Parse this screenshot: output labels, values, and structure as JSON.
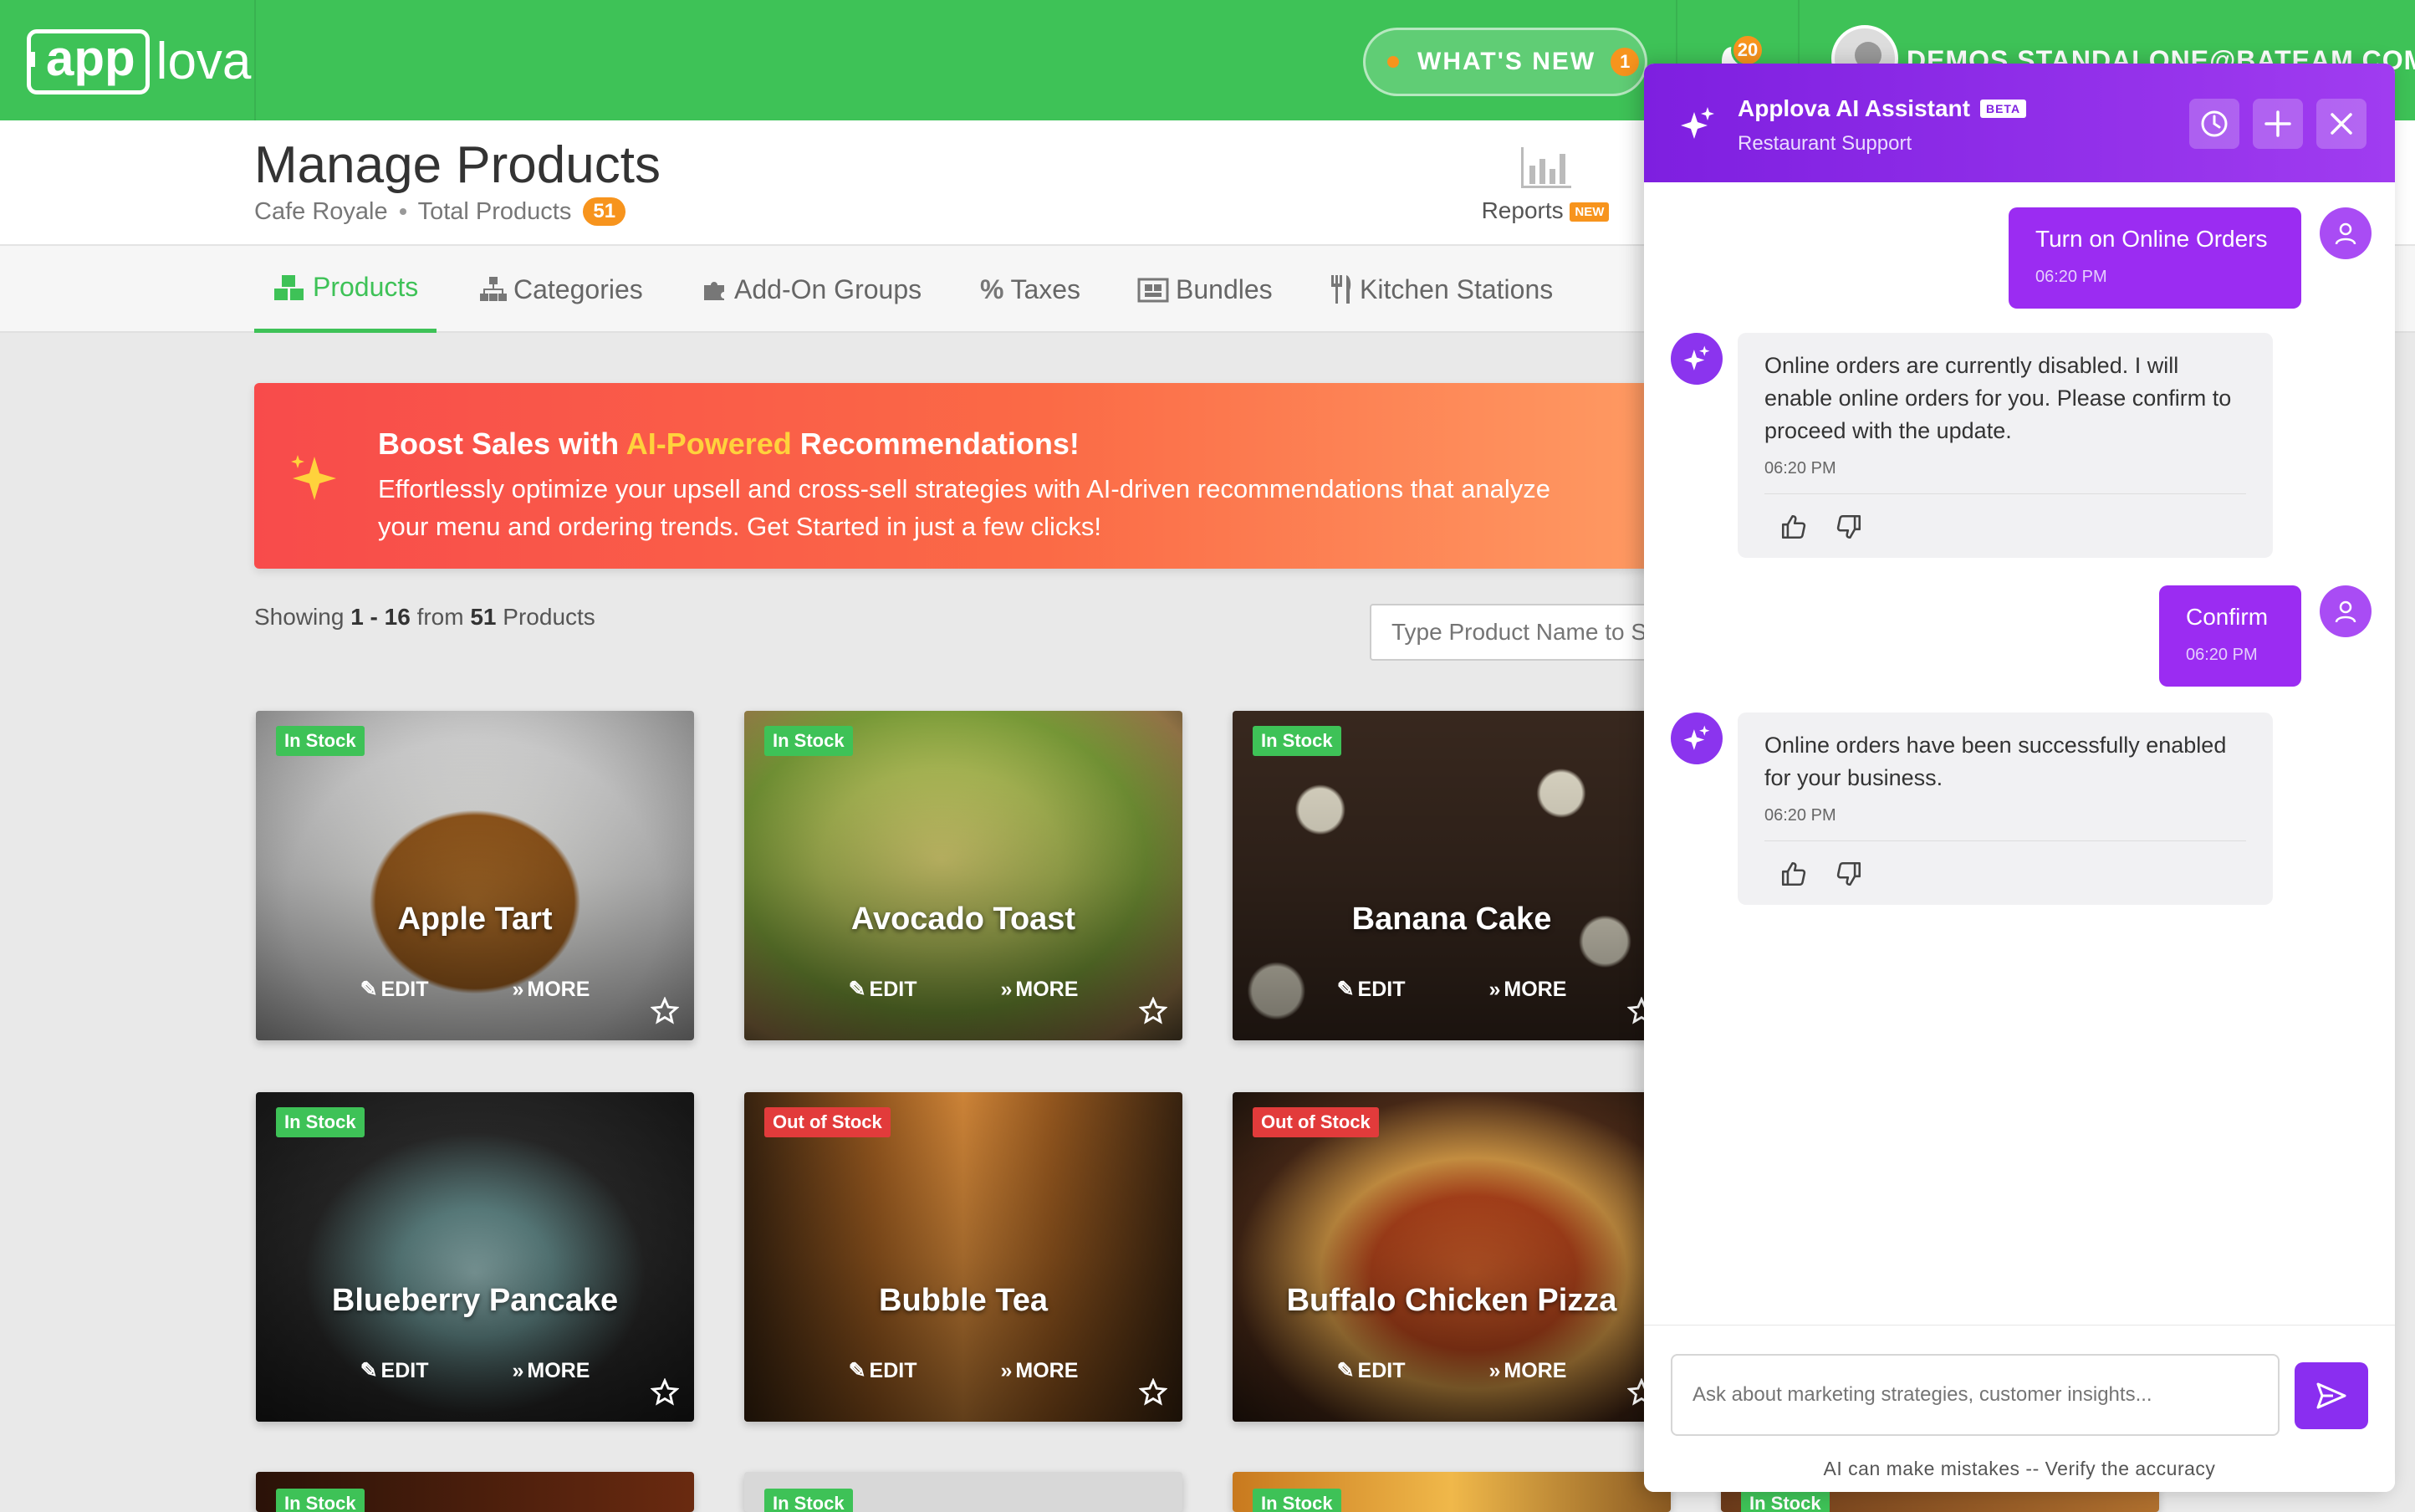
{
  "header": {
    "logo_box": "app",
    "logo_rest": "lova",
    "whats_new": "WHAT'S NEW",
    "whats_new_count": "1",
    "notification_count": "20",
    "user_email": "DEMOS.STANDALONE@BATEAM.COM"
  },
  "page": {
    "title": "Manage Products",
    "store": "Cafe Royale",
    "total_label": "Total Products",
    "total_count": "51",
    "reports_label": "Reports",
    "reports_tag": "NEW"
  },
  "tabs": [
    {
      "label": "Products",
      "icon": "cubes-icon",
      "active": true
    },
    {
      "label": "Categories",
      "icon": "sitemap-icon",
      "active": false
    },
    {
      "label": "Add-On Groups",
      "icon": "puzzle-icon",
      "active": false
    },
    {
      "label": "Taxes",
      "icon": "percent-icon",
      "active": false
    },
    {
      "label": "Bundles",
      "icon": "bundle-icon",
      "active": false
    },
    {
      "label": "Kitchen Stations",
      "icon": "utensils-icon",
      "active": false
    }
  ],
  "banner": {
    "title_pre": "Boost Sales with ",
    "title_hl": "AI-Powered",
    "title_post": " Recommendations!",
    "text": "Effortlessly optimize your upsell and cross-sell strategies with AI-driven recommendations that analyze your menu and ordering trends. Get Started in just a few clicks!"
  },
  "list": {
    "showing_pre": "Showing ",
    "range": "1 - 16",
    "from": " from ",
    "total": "51",
    "suffix": " Products",
    "search_placeholder": "Type Product Name to Search"
  },
  "products": [
    {
      "name": "Apple Tart",
      "stock": "In Stock",
      "in_stock": true,
      "edit": "EDIT",
      "more": "MORE"
    },
    {
      "name": "Avocado Toast",
      "stock": "In Stock",
      "in_stock": true,
      "edit": "EDIT",
      "more": "MORE"
    },
    {
      "name": "Banana Cake",
      "stock": "In Stock",
      "in_stock": true,
      "edit": "EDIT",
      "more": "MORE"
    },
    {
      "name": "Blueberry Pancake",
      "stock": "In Stock",
      "in_stock": true,
      "edit": "EDIT",
      "more": "MORE"
    },
    {
      "name": "Bubble Tea",
      "stock": "Out of Stock",
      "in_stock": false,
      "edit": "EDIT",
      "more": "MORE"
    },
    {
      "name": "Buffalo Chicken Pizza",
      "stock": "Out of Stock",
      "in_stock": false,
      "edit": "EDIT",
      "more": "MORE"
    },
    {
      "name": "",
      "stock": "In Stock",
      "in_stock": true
    },
    {
      "name": "",
      "stock": "In Stock",
      "in_stock": true
    },
    {
      "name": "",
      "stock": "In Stock",
      "in_stock": true
    },
    {
      "name": "",
      "stock": "In Stock",
      "in_stock": true
    }
  ],
  "assistant": {
    "title": "Applova AI Assistant",
    "badge": "BETA",
    "subtitle": "Restaurant Support",
    "messages": [
      {
        "from": "user",
        "text": "Turn on Online Orders",
        "time": "06:20 PM"
      },
      {
        "from": "bot",
        "text": "Online orders are currently disabled. I will enable online orders for you. Please confirm to proceed with the update.",
        "time": "06:20 PM"
      },
      {
        "from": "user",
        "text": "Confirm",
        "time": "06:20 PM"
      },
      {
        "from": "bot",
        "text": "Online orders have been successfully enabled for your business.",
        "time": "06:20 PM"
      }
    ],
    "input_placeholder": "Ask about marketing strategies, customer insights...",
    "disclaimer": "AI can make mistakes -- Verify the accuracy"
  },
  "colors": {
    "brand_green": "#3ec257",
    "accent_orange": "#f7941d",
    "assistant_purple": "#9b2cf2",
    "out_of_stock_red": "#e23b3b"
  }
}
